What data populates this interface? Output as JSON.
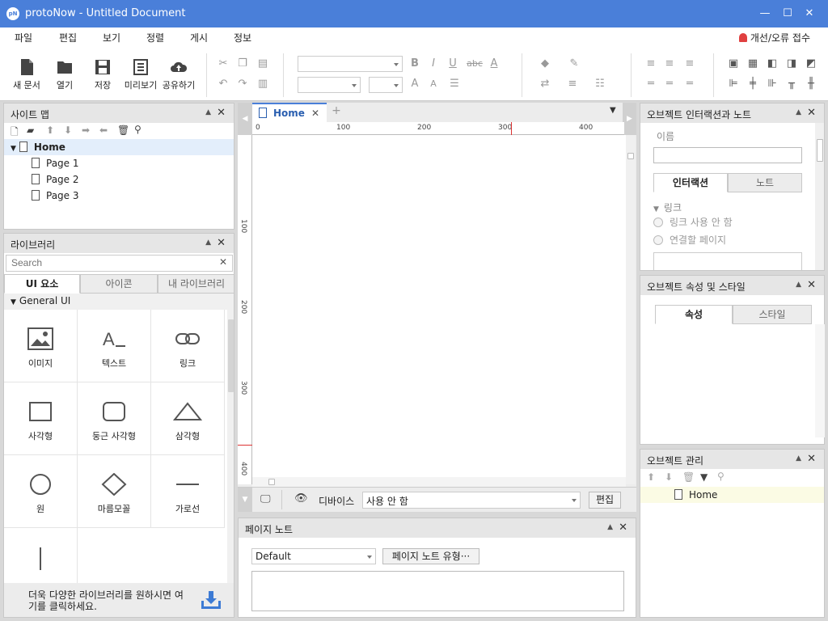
{
  "window": {
    "logo": "pN",
    "title": "protoNow - Untitled Document",
    "minimize": "—",
    "maximize": "☐",
    "close": "✕"
  },
  "menu": {
    "items": [
      "파일",
      "편집",
      "보기",
      "정렬",
      "게시",
      "정보"
    ],
    "report": "개선/오류 접수"
  },
  "toolbar": {
    "new": "새 문서",
    "open": "열기",
    "save": "저장",
    "preview": "미리보기",
    "share": "공유하기"
  },
  "sitemap": {
    "title": "사이트 맵",
    "root": "Home",
    "pages": [
      "Page 1",
      "Page 2",
      "Page 3"
    ]
  },
  "library": {
    "title": "라이브러리",
    "search_placeholder": "Search",
    "tabs": [
      "UI 요소",
      "아이콘",
      "내 라이브러리"
    ],
    "section": "General UI",
    "items": [
      "이미지",
      "텍스트",
      "링크",
      "사각형",
      "둥근 사각형",
      "삼각형",
      "원",
      "마름모꼴",
      "가로선"
    ],
    "footer": "더욱 다양한 라이브러리를 원하시면 여기를 클릭하세요."
  },
  "canvas": {
    "tab": "Home",
    "add_tab": "+",
    "ruler_x": [
      "0",
      "100",
      "200",
      "300",
      "400"
    ],
    "ruler_y": [
      "100",
      "200",
      "300",
      "400"
    ],
    "device_label": "디바이스",
    "device_value": "사용 안 함",
    "edit_button": "편집"
  },
  "page_notes": {
    "title": "페이지 노트",
    "select_value": "Default",
    "type_button": "페이지 노트 유형···"
  },
  "interaction": {
    "title": "오브젝트 인터랙션과 노트",
    "name_label": "이름",
    "tabs": [
      "인터랙션",
      "노트"
    ],
    "link_section": "링크",
    "options": [
      "링크 사용 안 함",
      "연결할 페이지"
    ]
  },
  "properties": {
    "title": "오브젝트 속성 및 스타일",
    "tabs": [
      "속성",
      "스타일"
    ]
  },
  "objects": {
    "title": "오브젝트 관리",
    "root": "Home"
  }
}
